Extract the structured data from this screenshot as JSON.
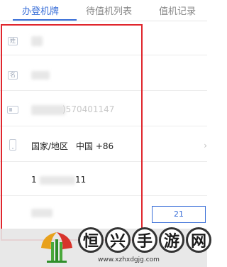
{
  "tabs": [
    {
      "label": "办登机牌",
      "active": true
    },
    {
      "label": "待值机列表",
      "active": false
    },
    {
      "label": "值机记录",
      "active": false
    }
  ],
  "form": {
    "surname_icon": "姓",
    "given_icon": "名",
    "id_number_tail": ")570401147",
    "region_label": "国家/地区",
    "region_value": "中国 +86",
    "phone_tail": "11"
  },
  "right_button": {
    "label": "21"
  },
  "watermark": {
    "chars": [
      "恒",
      "兴",
      "手",
      "游",
      "网"
    ],
    "url": "www.xzhxdgjg.com"
  },
  "colors": {
    "accent": "#3a6fd8",
    "highlight": "#e0262d"
  }
}
